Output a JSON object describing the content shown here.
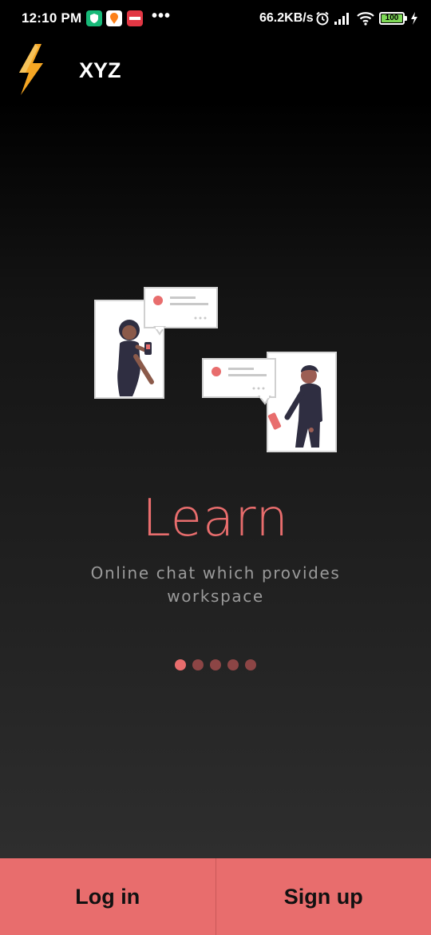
{
  "status_bar": {
    "time": "12:10 PM",
    "notification_dots": "•••",
    "network_speed": "66.2KB/s",
    "battery_level": "100",
    "icons": [
      "shield-app-icon",
      "swiggy-icon",
      "zomato-icon",
      "alarm-icon",
      "signal-icon",
      "wifi-icon",
      "battery-icon",
      "charging-icon"
    ]
  },
  "app_bar": {
    "title": "XYZ",
    "logo_icon": "lightning-bolt-icon",
    "logo_color": "#f5a623"
  },
  "onboarding": {
    "illustration_icon": "chat-people-illustration",
    "title": "Learn",
    "subtitle": "Online chat which provides workspace",
    "page_count": 5,
    "active_page": 1
  },
  "actions": {
    "login_label": "Log in",
    "signup_label": "Sign up"
  },
  "colors": {
    "accent": "#e86d6d",
    "background_top": "#000000",
    "background_bottom": "#2e2e2e",
    "subtitle": "#9a9a9a",
    "dot_inactive": "#8c4545"
  }
}
